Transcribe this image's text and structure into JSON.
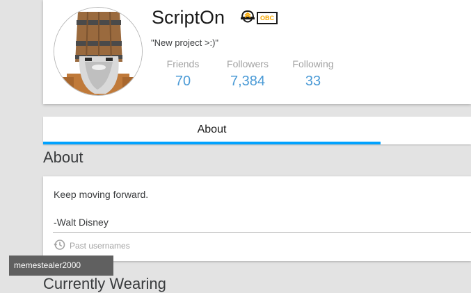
{
  "profile": {
    "username": "ScriptOn",
    "status": "\"New project >:)\"",
    "badge_text": "OBC",
    "stats": [
      {
        "label": "Friends",
        "value": "70"
      },
      {
        "label": "Followers",
        "value": "7,384"
      },
      {
        "label": "Following",
        "value": "33"
      }
    ]
  },
  "tabs": [
    {
      "label": "About",
      "active": true
    }
  ],
  "about": {
    "title": "About",
    "lines": [
      "Keep moving forward.",
      "-Walt Disney"
    ],
    "past_usernames_label": "Past usernames",
    "tooltip": "memestealer2000"
  },
  "next_section": {
    "title": "Currently Wearing"
  },
  "colors": {
    "accent_blue": "#00a2ff",
    "stat_value": "#4a9ad6",
    "badge_orange": "#f7a700",
    "background": "#e3e3e3"
  },
  "icons": [
    "builders-club-helmet-icon",
    "obc-badge-icon",
    "history-clock-icon"
  ]
}
